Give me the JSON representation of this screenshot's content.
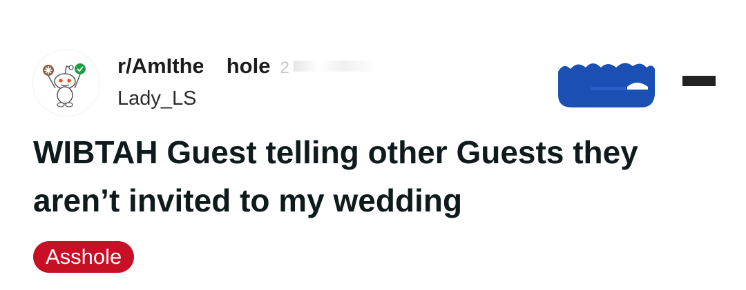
{
  "post": {
    "subreddit_prefix": "r/AmIthe",
    "subreddit_suffix": "hole",
    "age": "2",
    "username": "Lady_LS",
    "title": "WIBTAH Guest telling other Guests they aren’t invited to my wedding",
    "flair": "Asshole"
  },
  "icons": {
    "avatar": "snoo-avatar-icon",
    "banner": "join-banner-icon",
    "menu": "overflow-menu-icon"
  },
  "colors": {
    "flair_bg": "#c70f26",
    "banner_blue": "#1a4fb4",
    "check_green": "#1b9e4a"
  }
}
